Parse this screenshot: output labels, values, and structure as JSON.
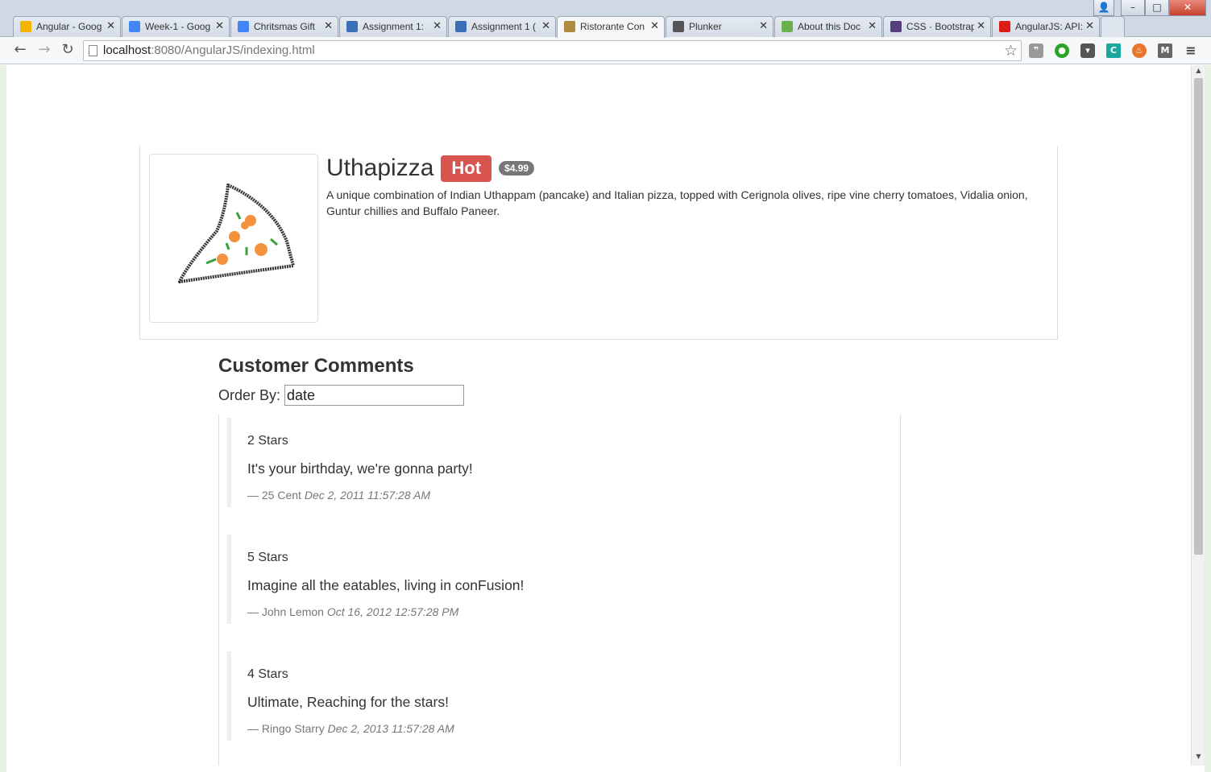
{
  "browser": {
    "tabs": [
      {
        "title": "Angular - Goog",
        "icon": "drive-icon",
        "color": "#f4b400"
      },
      {
        "title": "Week-1 - Goog",
        "icon": "docs-icon",
        "color": "#4285f4"
      },
      {
        "title": "Chritsmas Gift",
        "icon": "docs-icon",
        "color": "#4285f4"
      },
      {
        "title": "Assignment 1:",
        "icon": "infinity-icon",
        "color": "#3b6fb6"
      },
      {
        "title": "Assignment 1 (",
        "icon": "infinity-icon",
        "color": "#3b6fb6"
      },
      {
        "title": "Ristorante Con",
        "icon": "ristorante-icon",
        "color": "#b08a3e",
        "active": true
      },
      {
        "title": "Plunker",
        "icon": "plunker-icon",
        "color": "#555555"
      },
      {
        "title": "About this Doc",
        "icon": "circle-icon",
        "color": "#6ab04c"
      },
      {
        "title": "CSS · Bootstrap",
        "icon": "bootstrap-icon",
        "color": "#563d7c"
      },
      {
        "title": "AngularJS: API:",
        "icon": "angular-icon",
        "color": "#dd1b16"
      }
    ],
    "url_host": "localhost",
    "url_rest": ":8080/AngularJS/indexing.html"
  },
  "dish": {
    "name": "Uthapizza",
    "label": "Hot",
    "price": "$4.99",
    "description": "A unique combination of Indian Uthappam (pancake) and Italian pizza, topped with Cerignola olives, ripe vine cherry tomatoes, Vidalia onion, Guntur chillies and Buffalo Paneer."
  },
  "comments_section": {
    "title": "Customer Comments",
    "order_label": "Order By:",
    "order_value": "date",
    "comments": [
      {
        "stars": "2 Stars",
        "text": "It's your birthday, we're gonna party!",
        "author": "— 25 Cent",
        "date": "Dec 2, 2011 11:57:28 AM"
      },
      {
        "stars": "5 Stars",
        "text": "Imagine all the eatables, living in conFusion!",
        "author": "— John Lemon",
        "date": "Oct 16, 2012 12:57:28 PM"
      },
      {
        "stars": "4 Stars",
        "text": "Ultimate, Reaching for the stars!",
        "author": "— Ringo Starry",
        "date": "Dec 2, 2013 11:57:28 AM"
      }
    ]
  },
  "colors": {
    "hot_label": "#d9534f",
    "price_badge": "#777777",
    "chrome_frame": "#cfd8e3"
  }
}
